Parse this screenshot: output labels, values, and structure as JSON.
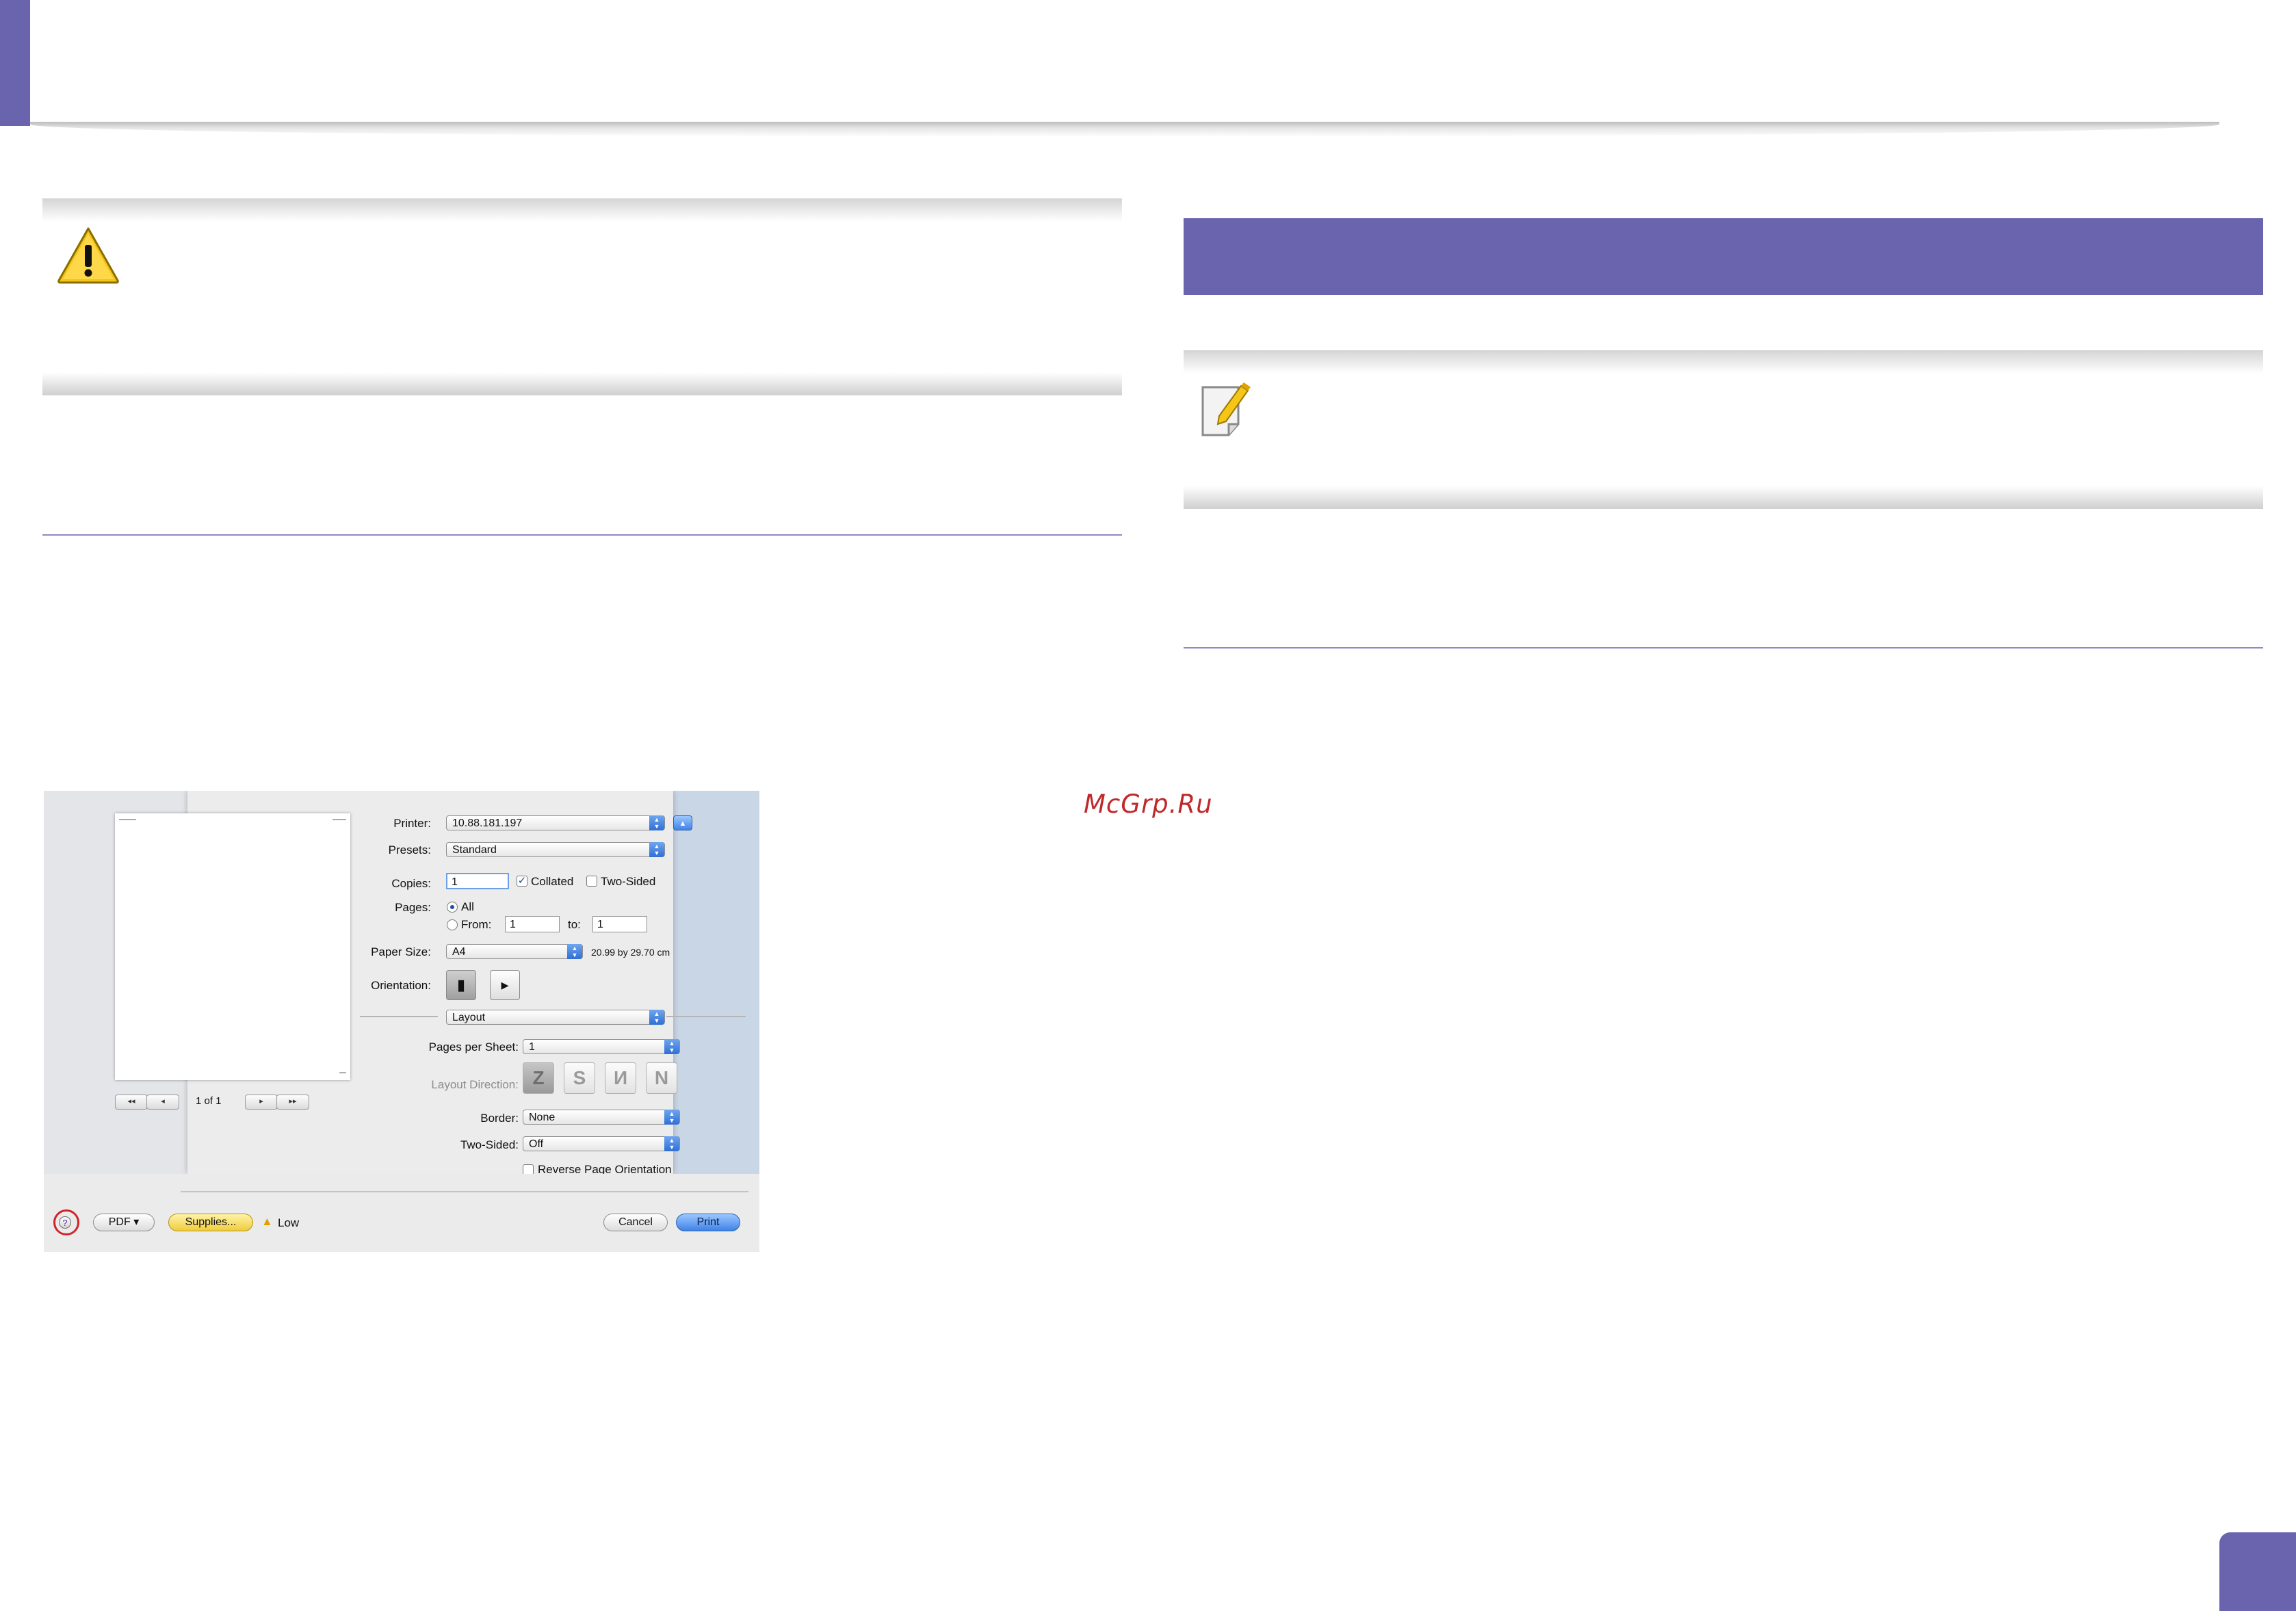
{
  "print_dialog": {
    "labels": {
      "printer": "Printer:",
      "presets": "Presets:",
      "copies": "Copies:",
      "pages": "Pages:",
      "paper_size": "Paper Size:",
      "orientation": "Orientation:",
      "pages_per_sheet": "Pages per Sheet:",
      "layout_direction": "Layout Direction:",
      "border": "Border:",
      "two_sided": "Two-Sided:"
    },
    "printer_value": "10.88.181.197",
    "presets_value": "Standard",
    "copies_value": "1",
    "collated_label": "Collated",
    "collated_checked": true,
    "two_sided_label": "Two-Sided",
    "two_sided_checked": false,
    "pages_all_label": "All",
    "pages_from_label": "From:",
    "pages_from_value": "1",
    "pages_to_label": "to:",
    "pages_to_value": "1",
    "paper_size_value": "A4",
    "paper_size_dims": "20.99 by 29.70 cm",
    "section_popup": "Layout",
    "pages_per_sheet_value": "1",
    "border_value": "None",
    "two_sided_value": "Off",
    "reverse_orientation_label": "Reverse Page Orientation",
    "reverse_orientation_checked": false,
    "preview_page_count": "1 of 1",
    "nav": {
      "first": "◂◂",
      "prev": "◂",
      "next": "▸",
      "last": "▸▸"
    },
    "buttons": {
      "help": "?",
      "pdf": "PDF ▾",
      "supplies": "Supplies...",
      "supply_status": "Low",
      "cancel": "Cancel",
      "print": "Print"
    }
  },
  "watermark": "McGrp.Ru",
  "colors": {
    "accent": "#6a63ad",
    "rule": "#8f8ac2",
    "caution_yellow": "#f5c518",
    "help_highlight": "#d0232a"
  }
}
